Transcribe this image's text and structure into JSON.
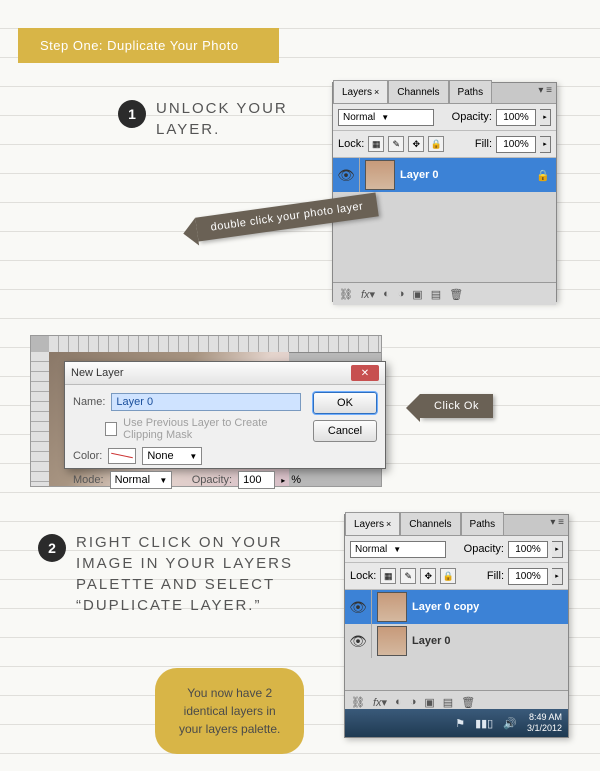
{
  "step_banner": "Step One: Duplicate Your Photo",
  "step1": {
    "num": "1",
    "title": "UNLOCK YOUR\nLAYER."
  },
  "step2": {
    "num": "2",
    "title": "RIGHT CLICK ON YOUR\nIMAGE IN YOUR LAYERS\nPALETTE AND SELECT\n“DUPLICATE LAYER.”"
  },
  "callouts": {
    "doubleclick": "double click your photo layer",
    "clickok": "Click Ok"
  },
  "tip": "You now have 2\nidentical layers in\nyour layers palette.",
  "panel": {
    "tabs": {
      "layers": "Layers",
      "channels": "Channels",
      "paths": "Paths"
    },
    "close_x": "×",
    "blend_mode": "Normal",
    "opacity_label": "Opacity:",
    "opacity_val": "100%",
    "lock_label": "Lock:",
    "fill_label": "Fill:",
    "fill_val": "100%"
  },
  "panel1": {
    "layer0": "Layer 0"
  },
  "panel2": {
    "layer0copy": "Layer 0 copy",
    "layer0": "Layer 0"
  },
  "dialog": {
    "title": "New Layer",
    "name_label": "Name:",
    "name_value": "Layer 0",
    "clip_label": "Use Previous Layer to Create Clipping Mask",
    "color_label": "Color:",
    "color_value": "None",
    "mode_label": "Mode:",
    "mode_value": "Normal",
    "opacity_label": "Opacity:",
    "opacity_value": "100",
    "percent": "%",
    "ok": "OK",
    "cancel": "Cancel"
  },
  "taskbar": {
    "time": "8:49 AM",
    "date": "3/1/2012"
  }
}
